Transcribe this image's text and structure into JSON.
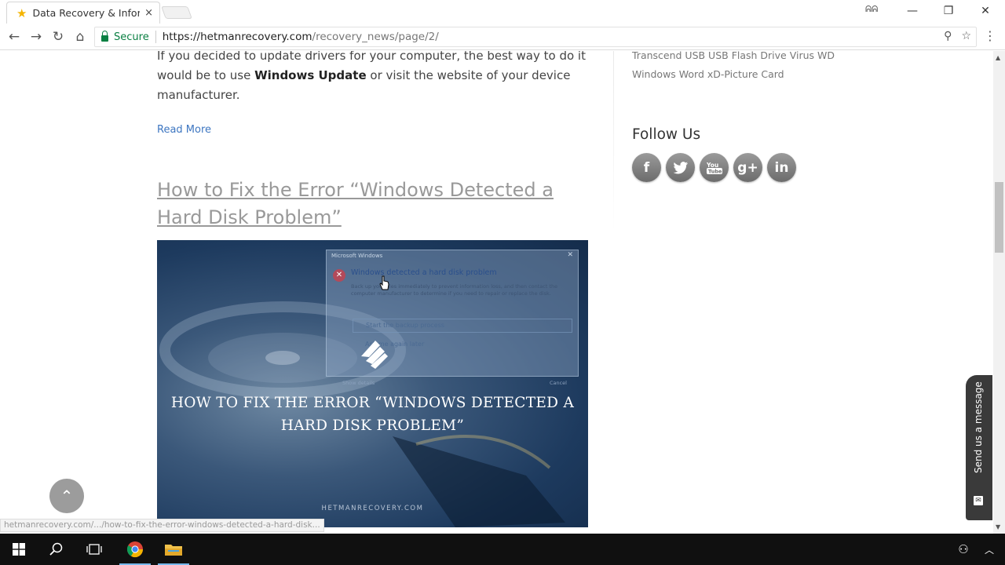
{
  "browser": {
    "tab_title": "Data Recovery & Informa",
    "tab_close": "×",
    "url_secure": "Secure",
    "url_host": "https://hetmanrecovery.com",
    "url_path": "/recovery_news/page/2/",
    "status_url": "hetmanrecovery.com/.../how-to-fix-the-error-windows-detected-a-hard-disk..."
  },
  "article": {
    "para_before": "If you decided to update drivers for your computer, the best way to do it would be to use ",
    "para_bold": "Windows Update",
    "para_after": " or visit the website of your device manufacturer.",
    "read_more": "Read More",
    "post_title": "How to Fix the Error “Windows Detected a Hard Disk Problem”"
  },
  "hero": {
    "dialog_title": "Microsoft Windows",
    "dialog_heading": "Windows detected a hard disk problem",
    "dialog_body": "Back up your files immediately to prevent information loss, and then contact the computer manufacturer to determine if you need to repair or replace the disk.",
    "dialog_option1": "Start the backup process",
    "dialog_option2": "Ask me again later",
    "dialog_details": "Show details",
    "dialog_cancel": "Cancel",
    "title": "HOW TO FIX THE ERROR “WINDOWS DETECTED A HARD DISK PROBLEM”",
    "brand": "HETMANRECOVERY.COM"
  },
  "sidebar": {
    "tags_line1": "Transcend USB USB Flash Drive Virus WD",
    "tags_line2": "Windows Word xD-Picture Card",
    "follow_title": "Follow Us",
    "social": [
      {
        "glyph": "f",
        "name": "facebook-icon"
      },
      {
        "glyph": "🐦",
        "name": "twitter-icon"
      },
      {
        "glyph": "You",
        "name": "youtube-icon"
      },
      {
        "glyph": "g+",
        "name": "google-plus-icon"
      },
      {
        "glyph": "in",
        "name": "linkedin-icon"
      }
    ]
  },
  "widgets": {
    "send_message": "Send us a message"
  },
  "colors": {
    "link": "#3d76c1",
    "secure": "#0b8043",
    "hero_bg": "#1d3a5e"
  }
}
